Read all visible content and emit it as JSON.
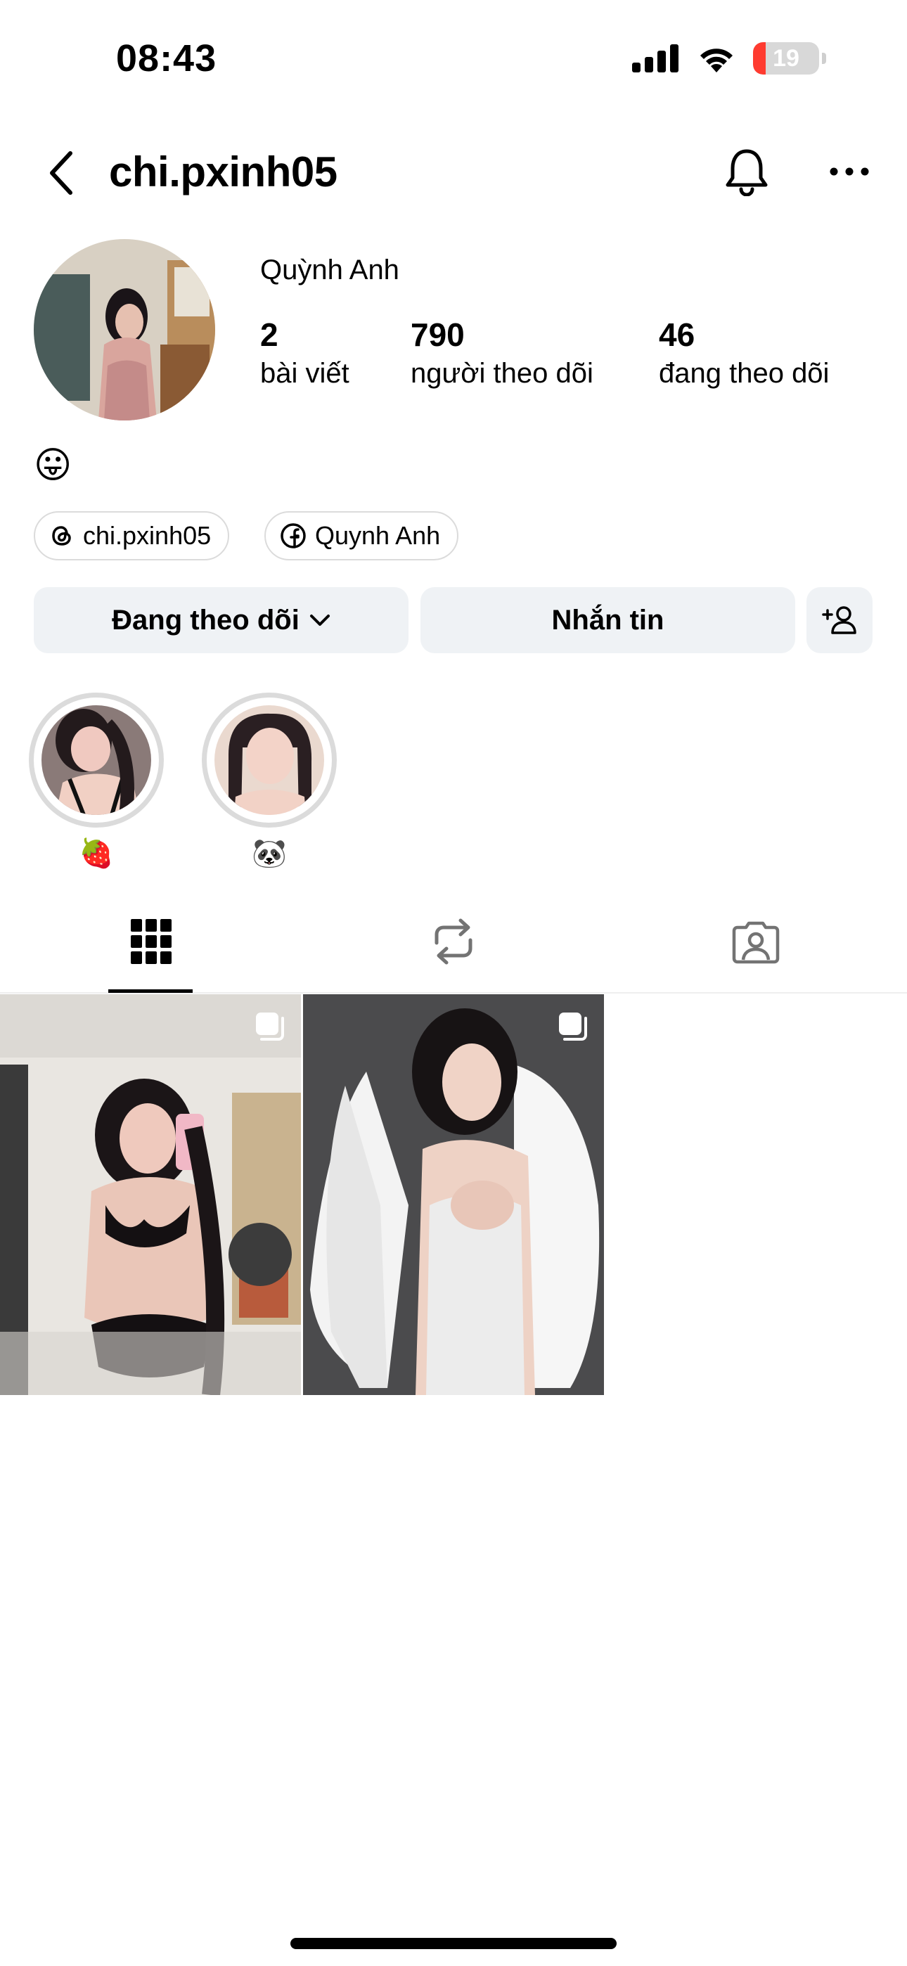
{
  "status_bar": {
    "time": "08:43",
    "battery_level": "19",
    "battery_fraction": 0.19,
    "icons": [
      "cellular-signal-icon",
      "wifi-icon",
      "battery-icon"
    ]
  },
  "header": {
    "username": "chi.pxinh05",
    "icons": [
      "back-arrow-icon",
      "bell-icon",
      "more-horizontal-icon"
    ]
  },
  "profile": {
    "display_name": "Quỳnh Anh",
    "stats": [
      {
        "value": "2",
        "label": "bài viết"
      },
      {
        "value": "790",
        "label": "người theo dõi"
      },
      {
        "value": "46",
        "label": "đang theo dõi"
      }
    ],
    "bio": "😛",
    "links": [
      {
        "icon": "threads-icon",
        "label": "chi.pxinh05"
      },
      {
        "icon": "facebook-icon",
        "label": "Quynh Anh"
      }
    ]
  },
  "actions": {
    "following_label": "Đang theo dõi",
    "message_label": "Nhắn tin",
    "suggest_icon": "add-person-icon"
  },
  "highlights": [
    {
      "label": "🍓"
    },
    {
      "label": "🐼"
    }
  ],
  "tabs": [
    {
      "name": "posts-grid",
      "icon": "grid-icon",
      "active": true
    },
    {
      "name": "reposts",
      "icon": "repost-icon",
      "active": false
    },
    {
      "name": "tagged",
      "icon": "tagged-person-icon",
      "active": false
    }
  ],
  "posts": [
    {
      "type": "carousel",
      "icon": "multiple-photos-icon"
    },
    {
      "type": "carousel",
      "icon": "multiple-photos-icon"
    }
  ],
  "colors": {
    "button_bg": "#eff2f5",
    "divider": "#dbdbdb",
    "battery_low": "#ff3b30"
  }
}
